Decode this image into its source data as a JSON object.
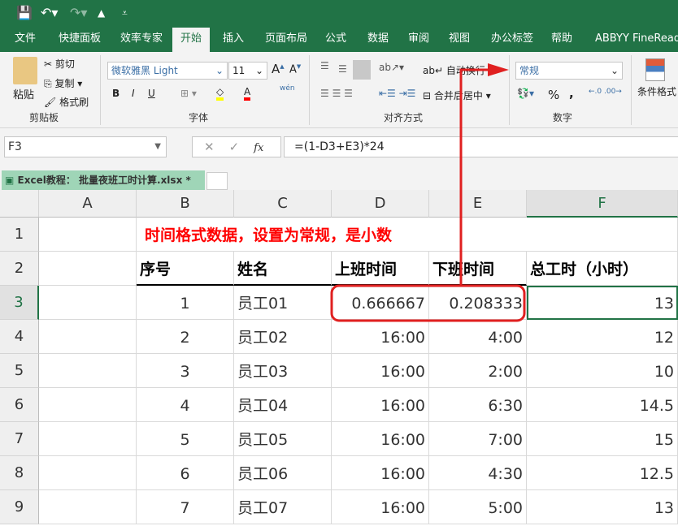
{
  "qat": {
    "icons": [
      "save-icon",
      "undo-icon",
      "redo-icon",
      "touch-mode-icon",
      "customize-icon"
    ]
  },
  "tabs": [
    "文件",
    "快捷面板",
    "效率专家",
    "开始",
    "插入",
    "页面布局",
    "公式",
    "数据",
    "审阅",
    "视图",
    "办公标签",
    "帮助",
    "ABBYY FineReader"
  ],
  "active_tab": "开始",
  "ribbon": {
    "clipboard": {
      "paste": "粘贴",
      "cut": "剪切",
      "copy": "复制",
      "format_painter": "格式刷",
      "label": "剪贴板"
    },
    "font": {
      "name": "微软雅黑 Light",
      "size": "11",
      "bold": "B",
      "italic": "I",
      "underline": "U",
      "phonetic": "wén",
      "label": "字体"
    },
    "alignment": {
      "wrap": "自动换行",
      "merge": "合并后居中",
      "label": "对齐方式"
    },
    "number": {
      "format": "常规",
      "percent": "%",
      "comma": ",",
      "label": "数字"
    },
    "styles": {
      "conditional": "条件格式"
    }
  },
  "formula_bar": {
    "name_box": "F3",
    "fx": "fx",
    "formula": "=(1-D3+E3)*24"
  },
  "workbook_tab": {
    "title": "Excel教程： 批量夜班工时计算.xlsx *"
  },
  "columns": [
    "A",
    "B",
    "C",
    "D",
    "E",
    "F"
  ],
  "rows": [
    "1",
    "2",
    "3",
    "4",
    "5",
    "6",
    "7",
    "8",
    "9"
  ],
  "annotation": "时间格式数据，设置为常规，是小数",
  "headers": [
    "序号",
    "姓名",
    "上班时间",
    "下班时间",
    "总工时（小时）"
  ],
  "data": [
    [
      "1",
      "员工01",
      "0.666667",
      "0.208333",
      "13"
    ],
    [
      "2",
      "员工02",
      "16:00",
      "4:00",
      "12"
    ],
    [
      "3",
      "员工03",
      "16:00",
      "2:00",
      "10"
    ],
    [
      "4",
      "员工04",
      "16:00",
      "6:30",
      "14.5"
    ],
    [
      "5",
      "员工05",
      "16:00",
      "7:00",
      "15"
    ],
    [
      "6",
      "员工06",
      "16:00",
      "4:30",
      "12.5"
    ],
    [
      "7",
      "员工07",
      "16:00",
      "5:00",
      "13"
    ]
  ],
  "colors": {
    "brand": "#217346",
    "annotation": "#ff0000",
    "selection": "#217346"
  }
}
